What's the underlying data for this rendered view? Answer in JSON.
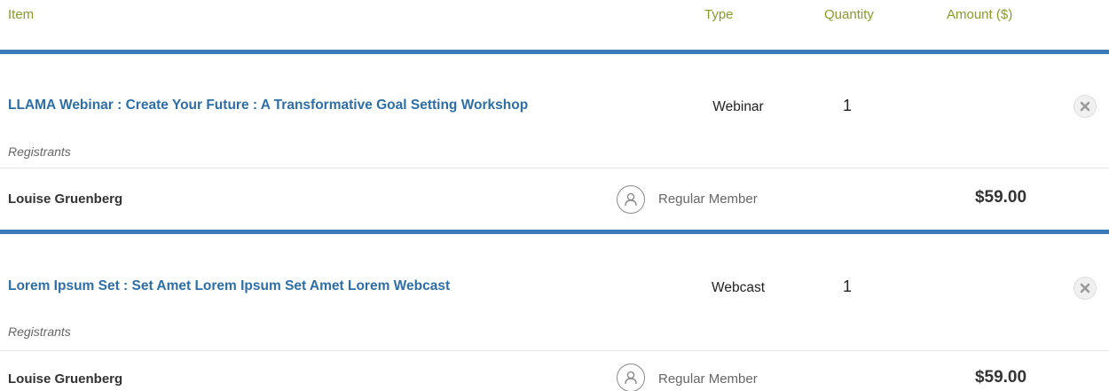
{
  "header": {
    "item": "Item",
    "type": "Type",
    "quantity": "Quantity",
    "amount": "Amount ($)"
  },
  "items": [
    {
      "title": "LLAMA Webinar : Create Your Future : A Transformative Goal Setting Workshop",
      "type": "Webinar",
      "quantity": "1",
      "registrants_label": "Registrants",
      "registrant": {
        "name": "Louise Gruenberg",
        "member_type": "Regular Member",
        "amount": "$59.00"
      }
    },
    {
      "title": "Lorem Ipsum Set : Set Amet Lorem Ipsum Set Amet Lorem Webcast",
      "type": "Webcast",
      "quantity": "1",
      "registrants_label": "Registrants",
      "registrant": {
        "name": "Louise Gruenberg",
        "member_type": "Regular Member",
        "amount": "$59.00"
      }
    }
  ],
  "colors": {
    "header_text": "#8a9a2a",
    "accent_blue": "#3a7ab8",
    "link_blue": "#2e6ea6"
  },
  "icons": {
    "remove": "close-icon",
    "registrant": "user-icon"
  }
}
